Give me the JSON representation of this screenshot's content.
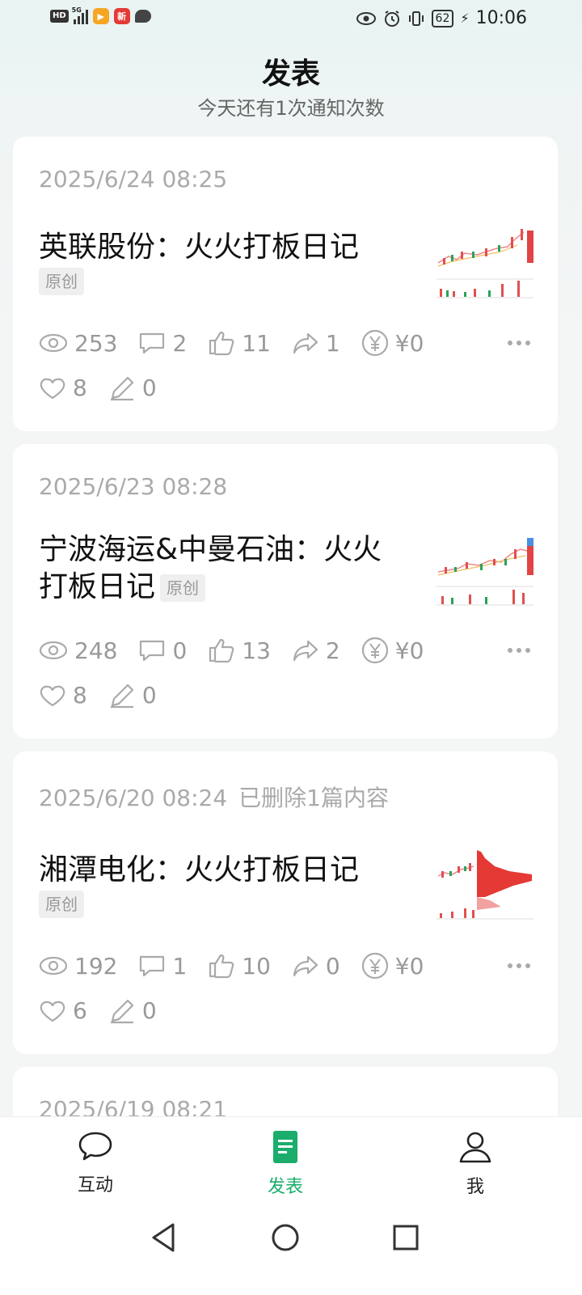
{
  "status_bar": {
    "time": "10:06",
    "battery": "62",
    "network": "5G",
    "hd": "HD"
  },
  "header": {
    "title": "发表",
    "subtitle": "今天还有1次通知次数"
  },
  "posts": [
    {
      "date": "2025/6/24 08:25",
      "note": "",
      "title": "英联股份：火火打板日记",
      "tag": "原创",
      "views": "253",
      "comments": "2",
      "likes": "11",
      "shares": "1",
      "earnings": "¥0",
      "favorites": "8",
      "edits": "0"
    },
    {
      "date": "2025/6/23 08:28",
      "note": "",
      "title": "宁波海运&中曼石油：火火打板日记",
      "tag": "原创",
      "views": "248",
      "comments": "0",
      "likes": "13",
      "shares": "2",
      "earnings": "¥0",
      "favorites": "8",
      "edits": "0"
    },
    {
      "date": "2025/6/20 08:24",
      "note": "已删除1篇内容",
      "title": "湘潭电化：火火打板日记",
      "tag": "原创",
      "views": "192",
      "comments": "1",
      "likes": "10",
      "shares": "0",
      "earnings": "¥0",
      "favorites": "6",
      "edits": "0"
    },
    {
      "date": "2025/6/19 08:21"
    }
  ],
  "bottom_nav": {
    "items": [
      {
        "label": "互动",
        "icon": "chat-bubble-icon"
      },
      {
        "label": "发表",
        "icon": "document-icon",
        "active": true
      },
      {
        "label": "我",
        "icon": "person-icon"
      }
    ]
  },
  "colors": {
    "accent": "#1aad6b",
    "muted_text": "#999999"
  }
}
